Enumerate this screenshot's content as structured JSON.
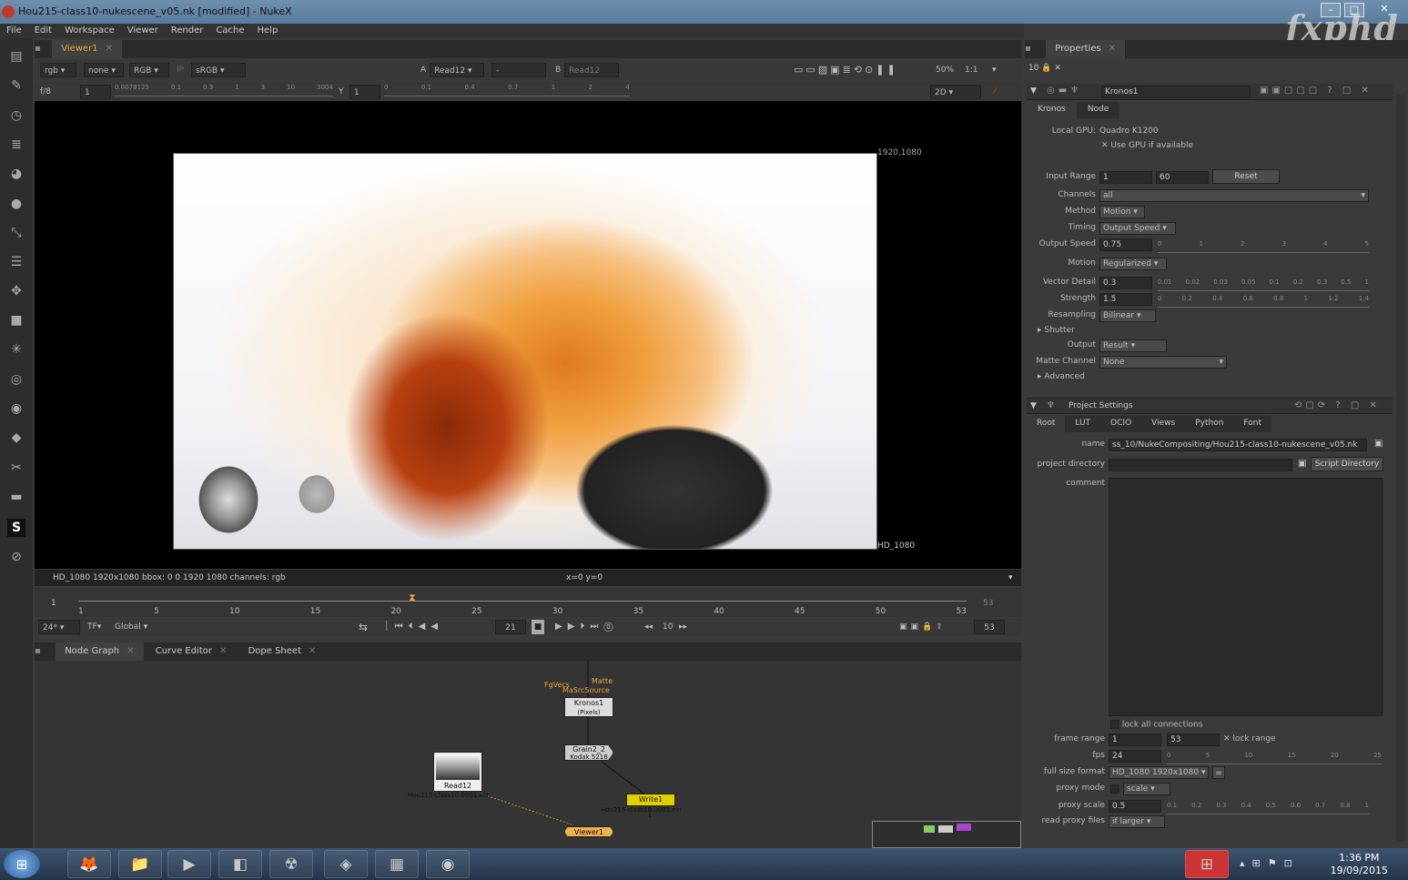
{
  "window": {
    "title": "Hou215-class10-nukescene_v05.nk [modified] - NukeX",
    "watermark": "fxphd"
  },
  "menu": [
    "File",
    "Edit",
    "Workspace",
    "Viewer",
    "Render",
    "Cache",
    "Help"
  ],
  "viewer": {
    "tab": "Viewer1",
    "channels": "rgb",
    "alpha": "none",
    "display": "RGB",
    "ip": "IP",
    "lut": "sRGB",
    "a_label": "A",
    "a_input": "Read12",
    "compare": "-",
    "b_label": "B",
    "b_input": "Read12",
    "zoom": "50%",
    "ratio": "1:1",
    "fstop": "f/8",
    "gain": "1",
    "y_label": "Y",
    "gamma": "1",
    "mode": "2D",
    "gain_ticks": [
      "0.0078125",
      "0.1",
      "0.3",
      "1",
      "3",
      "10",
      "3004"
    ],
    "gamma_ticks": [
      "0",
      "0.1",
      "0.4",
      "0.7",
      "1",
      "2",
      "4"
    ],
    "corner_tr": "1920,1080",
    "corner_br": "HD_1080",
    "status_left": "HD_1080 1920x1080  bbox: 0 0 1920 1080 channels: rgb",
    "status_mid": "x=0 y=0"
  },
  "timeline": {
    "start": "1",
    "end": "53",
    "ticks": [
      "1",
      "5",
      "10",
      "15",
      "20",
      "25",
      "30",
      "35",
      "40",
      "45",
      "50",
      "53"
    ],
    "current": "21",
    "fps": "24*",
    "tf": "TF",
    "scope": "Global",
    "step": "10",
    "end_field": "53"
  },
  "nodegraph": {
    "tabs": [
      "Node Graph",
      "Curve Editor",
      "Dope Sheet"
    ],
    "kronos": {
      "label": "Kronos1",
      "sub": "(Pixels)"
    },
    "kronos_inputs": [
      "FgVecs",
      "MaSrcSource",
      "Matte"
    ],
    "grain": {
      "label": "Grain2_2",
      "sub": "Kodak 5218"
    },
    "read": {
      "label": "Read12",
      "file": "Hou215-class10.0001.exr"
    },
    "write": {
      "label": "Write1",
      "file": "Hou215-class10.0001.exr"
    },
    "viewer": {
      "label": "Viewer1"
    }
  },
  "properties": {
    "title": "Properties",
    "count": "10",
    "kronos": {
      "name": "Kronos1",
      "tabs": [
        "Kronos",
        "Node"
      ],
      "gpu_label": "Local GPU:",
      "gpu": "Quadro K1200",
      "use_gpu": "Use GPU if available",
      "input_range_label": "Input Range",
      "input_range_start": "1",
      "input_range_end": "60",
      "reset": "Reset",
      "channels_label": "Channels",
      "channels": "all",
      "method_label": "Method",
      "method": "Motion",
      "timing_label": "Timing",
      "timing": "Output Speed",
      "output_speed_label": "Output Speed",
      "output_speed": "0.75",
      "output_speed_ticks": [
        "0",
        "1",
        "2",
        "3",
        "4",
        "5"
      ],
      "motion_label": "Motion",
      "motion": "Regularized",
      "vector_detail_label": "Vector Detail",
      "vector_detail": "0.3",
      "vector_detail_ticks": [
        "0.01",
        "0.02",
        "0.03",
        "0.05",
        "0.1",
        "0.2",
        "0.3",
        "0.5",
        "1"
      ],
      "strength_label": "Strength",
      "strength": "1.5",
      "strength_ticks": [
        "0",
        "0.2",
        "0.4",
        "0.6",
        "0.8",
        "1",
        "1.2",
        "1.4"
      ],
      "resampling_label": "Resampling",
      "resampling": "Bilinear",
      "shutter_label": "Shutter",
      "output_label": "Output",
      "output": "Result",
      "matte_label": "Matte Channel",
      "matte": "None",
      "advanced_label": "Advanced"
    },
    "project": {
      "title": "Project Settings",
      "tabs": [
        "Root",
        "LUT",
        "OCIO",
        "Views",
        "Python",
        "Font"
      ],
      "name_label": "name",
      "name": "ss_10/NukeCompositing/Hou215-class10-nukescene_v05.nk",
      "dir_label": "project directory",
      "dir": "",
      "script_dir": "Script Directory",
      "comment_label": "comment",
      "comment": "",
      "lock_connections": "lock all connections",
      "frame_range_label": "frame range",
      "frame_start": "1",
      "frame_end": "53",
      "lock_range": "lock range",
      "fps_label": "fps",
      "fps": "24",
      "fps_ticks": [
        "0",
        "5",
        "10",
        "15",
        "20",
        "25"
      ],
      "format_label": "full size format",
      "format": "HD_1080 1920x1080",
      "proxy_mode_label": "proxy mode",
      "proxy_mode": "scale",
      "proxy_scale_label": "proxy scale",
      "proxy_scale": "0.5",
      "proxy_scale_ticks": [
        "0.1",
        "0.2",
        "0.3",
        "0.4",
        "0.5",
        "0.6",
        "0.7",
        "0.8",
        "1"
      ],
      "read_proxy_label": "read proxy files",
      "read_proxy": "if larger"
    }
  },
  "taskbar": {
    "time": "1:36 PM",
    "date": "19/09/2015"
  }
}
